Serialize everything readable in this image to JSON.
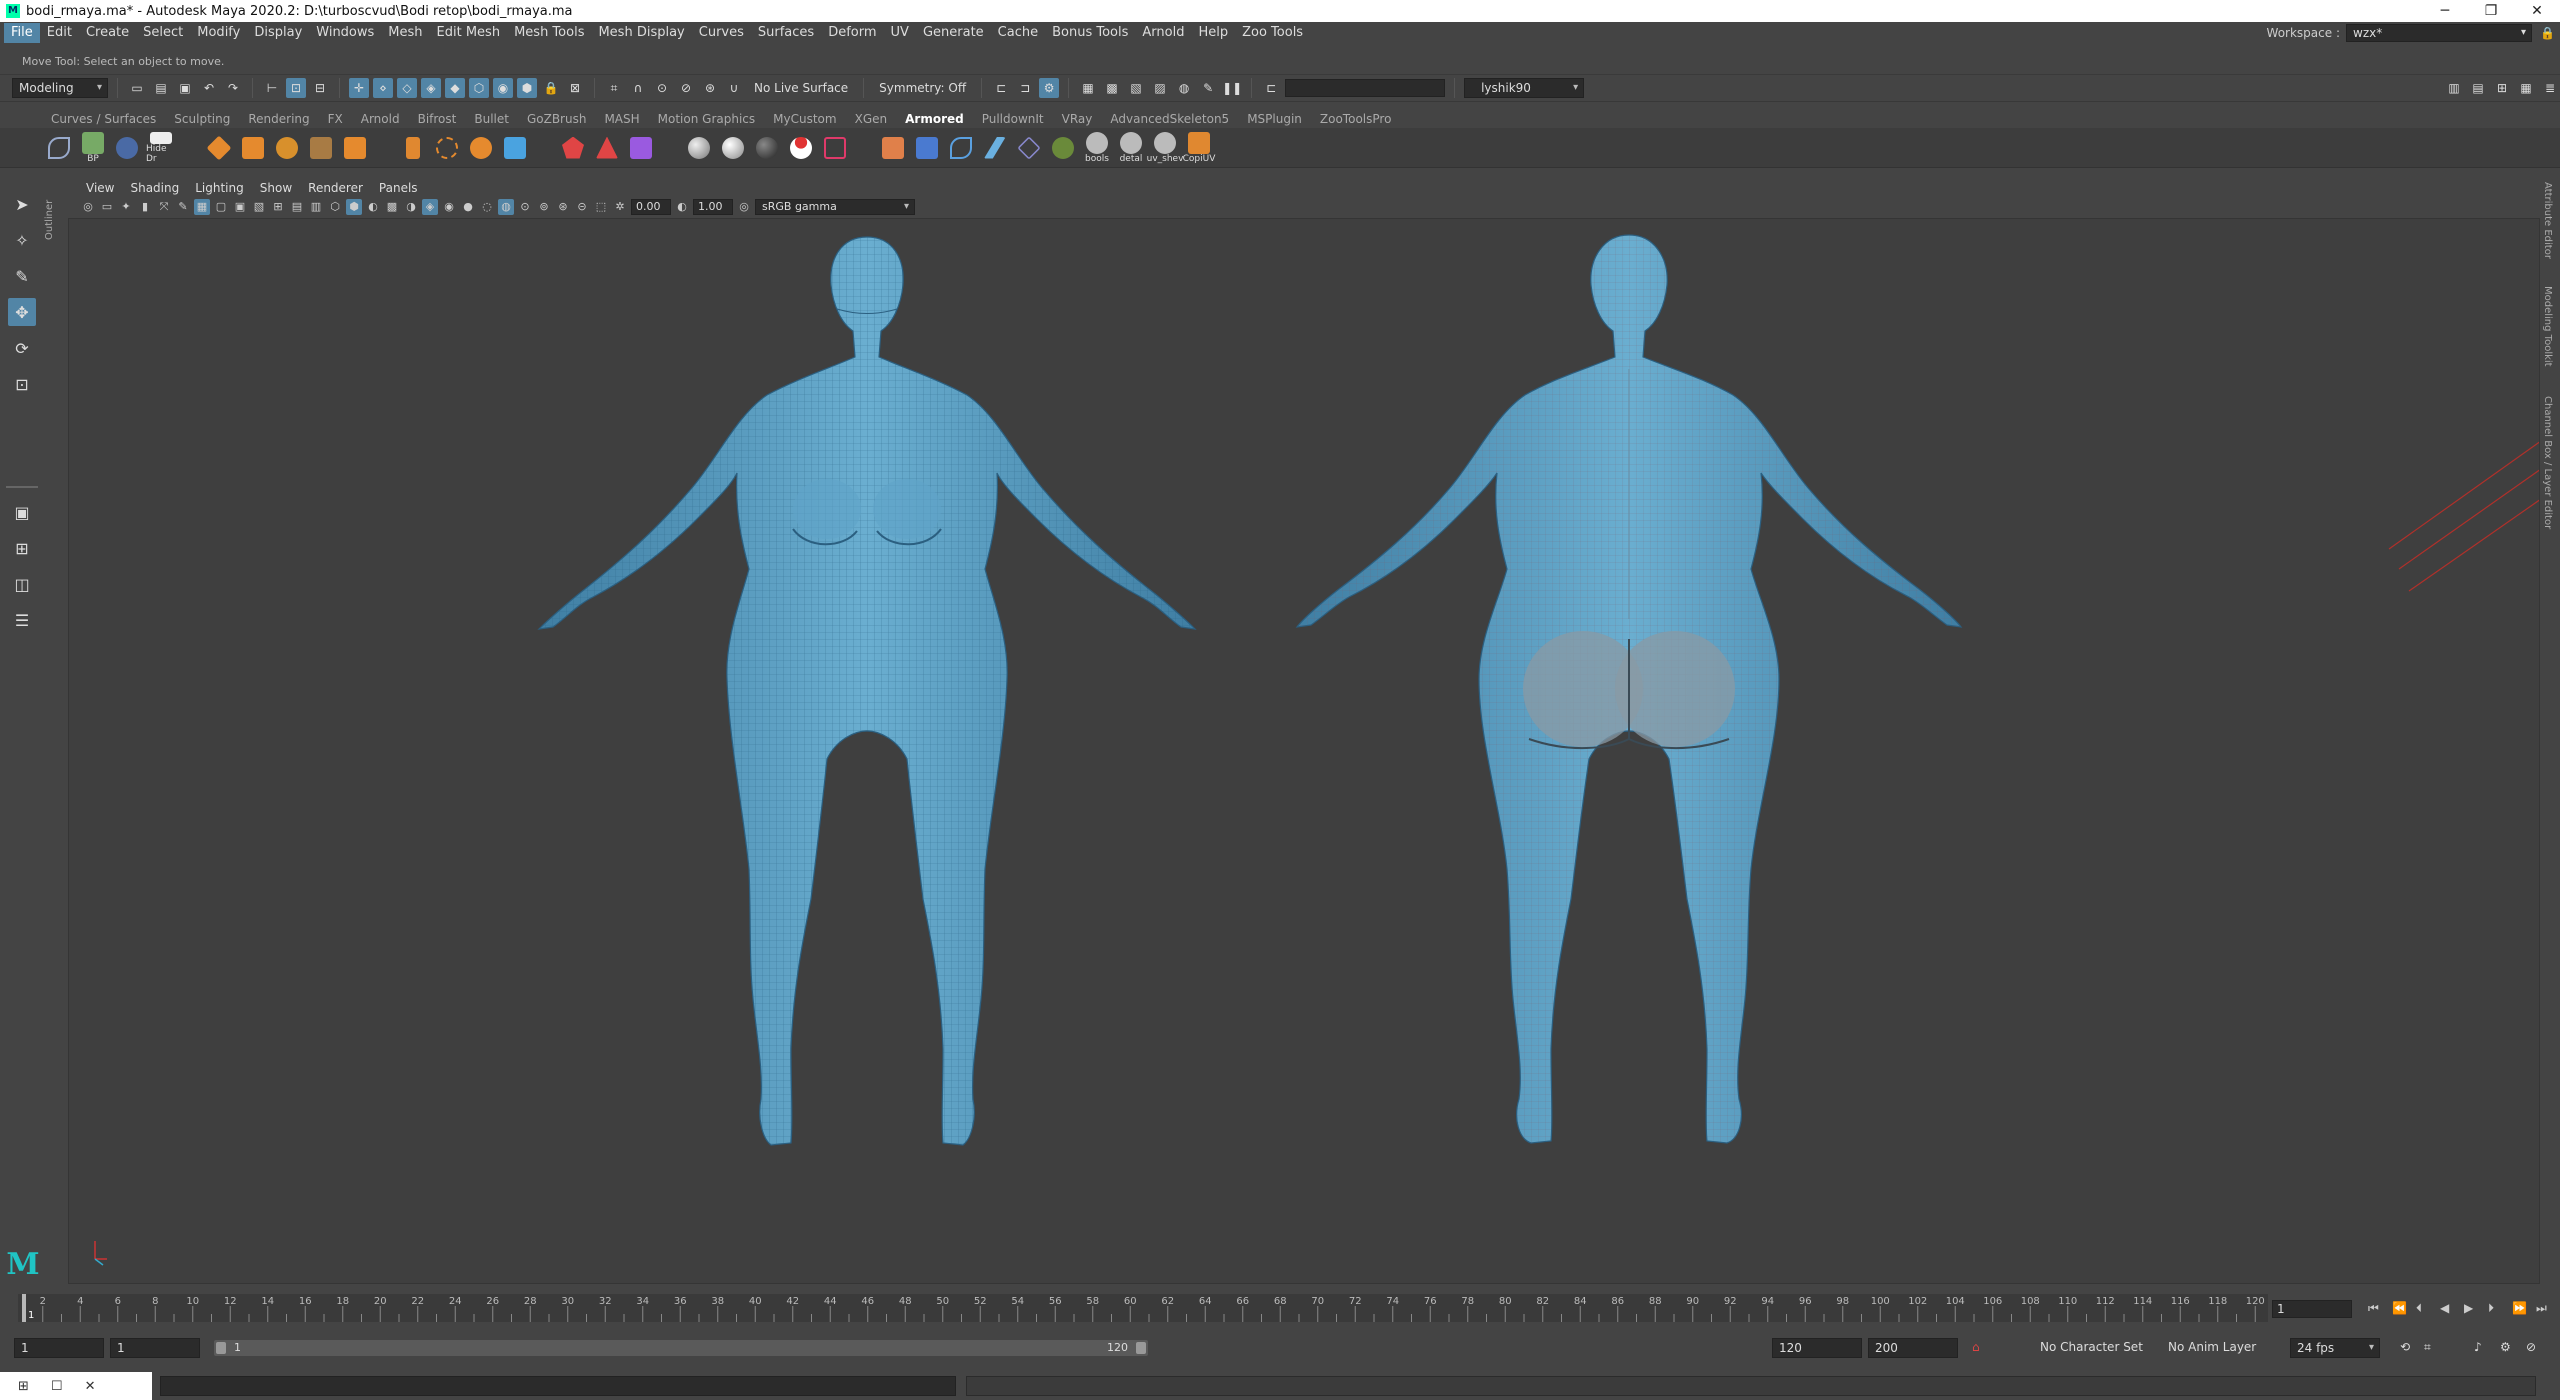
{
  "window": {
    "title": "bodi_rmaya.ma* - Autodesk Maya 2020.2: D:\\turboscvud\\Bodi retop\\bodi_rmaya.ma",
    "app_icon": "maya-icon",
    "controls": [
      "minimize-icon",
      "restore-icon",
      "close-icon"
    ]
  },
  "menubar": {
    "items": [
      "File",
      "Edit",
      "Create",
      "Select",
      "Modify",
      "Display",
      "Windows",
      "Mesh",
      "Edit Mesh",
      "Mesh Tools",
      "Mesh Display",
      "Curves",
      "Surfaces",
      "Deform",
      "UV",
      "Generate",
      "Cache",
      "Bonus Tools",
      "Arnold",
      "Help",
      "Zoo Tools"
    ],
    "active": "File",
    "workspace_label": "Workspace :",
    "workspace_value": "wzx*"
  },
  "helpline": {
    "text": "Move Tool: Select an object to move."
  },
  "statusline": {
    "menuset": "Modeling",
    "live_surface": "No Live Surface",
    "symmetry": "Symmetry: Off",
    "user": "lyshik90"
  },
  "shelf": {
    "tabs": [
      "Curves / Surfaces",
      "Sculpting",
      "Rendering",
      "FX",
      "Arnold",
      "Bifrost",
      "Bullet",
      "GoZBrush",
      "MASH",
      "Motion Graphics",
      "MyCustom",
      "XGen",
      "Armored",
      "PulldownIt",
      "VRay",
      "AdvancedSkeleton5",
      "MSPlugin",
      "ZooToolsPro"
    ],
    "active_tab": "Armored",
    "button_labels": [
      "BP",
      "Hide Dr",
      "bools",
      "detal",
      "uv_shev",
      "CopiUV"
    ]
  },
  "panel": {
    "menus": [
      "View",
      "Shading",
      "Lighting",
      "Show",
      "Renderer",
      "Panels"
    ],
    "exposure": "0.00",
    "gamma": "1.00",
    "colorspace": "sRGB gamma"
  },
  "right_tabs": [
    "Attribute Editor",
    "Modeling Toolkit",
    "Channel Box / Layer Editor"
  ],
  "outliner_tab": "Outliner",
  "timeline": {
    "ticks": [
      "2",
      "4",
      "6",
      "8",
      "10",
      "12",
      "14",
      "16",
      "18",
      "20",
      "22",
      "24",
      "26",
      "28",
      "30",
      "32",
      "34",
      "36",
      "38",
      "40",
      "42",
      "44",
      "46",
      "48",
      "50",
      "52",
      "54",
      "56",
      "58",
      "60",
      "62",
      "64",
      "66",
      "68",
      "70",
      "72",
      "74",
      "76",
      "78",
      "80",
      "82",
      "84",
      "86",
      "88",
      "90",
      "92",
      "94",
      "96",
      "98",
      "100",
      "102",
      "104",
      "106",
      "108",
      "110",
      "112",
      "114",
      "116",
      "118",
      "120"
    ],
    "playhead": "1",
    "current_frame": "1"
  },
  "range": {
    "start": "1",
    "playback_start": "1",
    "bar_start": "1",
    "bar_end": "120",
    "playback_end": "120",
    "end": "200",
    "character_set": "No Character Set",
    "anim_layer": "No Anim Layer",
    "fps": "24 fps"
  },
  "colors": {
    "accent": "#5285a6",
    "mesh": "#5b9ec4",
    "viewport_bg": "#3f3f3f"
  }
}
